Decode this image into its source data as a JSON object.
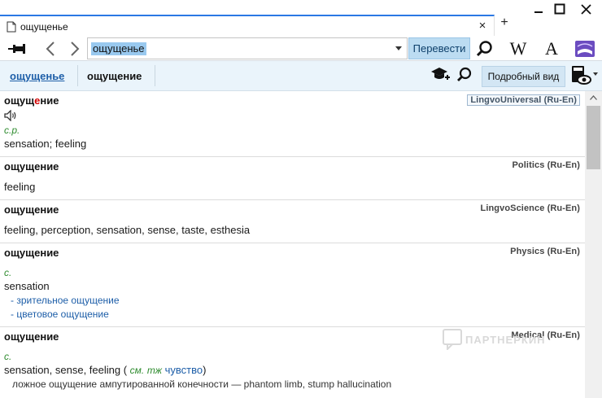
{
  "window": {
    "tab_title": "ощущенье",
    "tab_close": "×",
    "tab_add": "+"
  },
  "toolbar": {
    "search_value": "ощущенье",
    "translate_label": "Перевести",
    "wiki_label": "W",
    "font_label": "A"
  },
  "subbar": {
    "query_link": "ощущенье",
    "result_word": "ощущение",
    "detail_view_label": "Подробный вид"
  },
  "entries": [
    {
      "headword_pre": "ощущ",
      "headword_stress": "е",
      "headword_post": "ние",
      "dictionary": "LingvoUniversal (Ru-En)",
      "grammar": "с.р.",
      "translation": "sensation; feeling"
    },
    {
      "headword": "ощущение",
      "dictionary": "Politics (Ru-En)",
      "translation": "feeling"
    },
    {
      "headword": "ощущение",
      "dictionary": "LingvoScience (Ru-En)",
      "translation": "feeling, perception, sensation, sense, taste, esthesia"
    },
    {
      "headword": "ощущение",
      "dictionary": "Physics (Ru-En)",
      "grammar": "с.",
      "translation": "sensation",
      "subentries": [
        "- зрительное ощущение",
        "- цветовое ощущение"
      ]
    },
    {
      "headword": "ощущение",
      "dictionary": "Medical (Ru-En)",
      "grammar": "с.",
      "translation_main": "sensation, sense, feeling (",
      "ref_see": "см.",
      "ref_also": "тж",
      "ref_word": "чувство",
      "ref_close": ")",
      "example_ru": "ложное ощущение ампутированной конечности",
      "example_en": " — phantom limb, stump hallucination"
    }
  ],
  "watermark": "ПАРТНЕРКИН"
}
